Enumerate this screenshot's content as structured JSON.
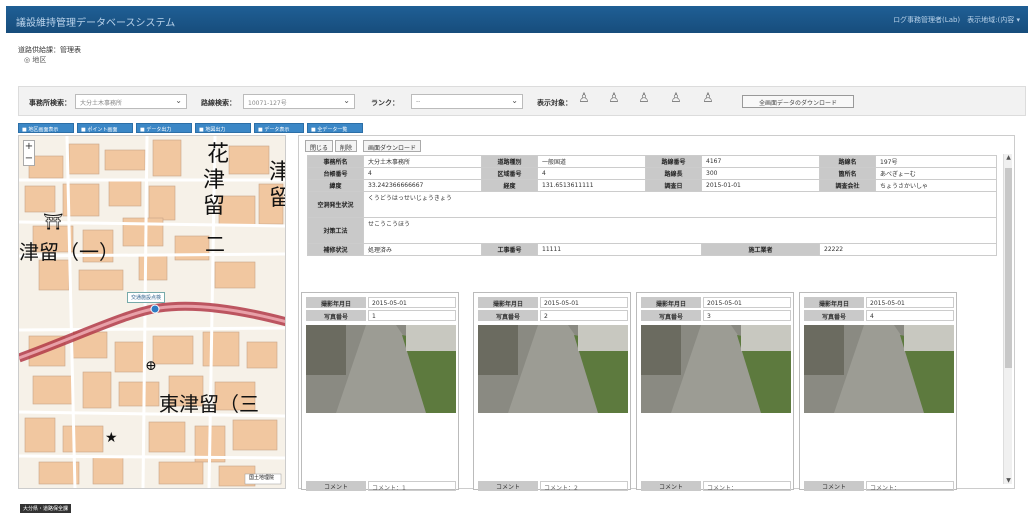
{
  "header": {
    "title": "議設維持管理データベースシステム",
    "user": "ログ事務管理者(Lab)　表示地域:(内容 ▾"
  },
  "breadcrumb": {
    "path": "道路供給課：管理表",
    "sub": "◎ 地区"
  },
  "filters": {
    "office_label": "事務所検索：",
    "office_value": "大分土木事務所",
    "road_label": "路線検索：",
    "road_value": "10071-127号",
    "rank_label": "ランク：",
    "rank_value": "--",
    "display_label": "表示対象：",
    "download_label": "全画面データのダウンロード"
  },
  "map_buttons": [
    "■ 地区画面表示",
    "■ ポイント画面",
    "■ データ出力",
    "■ 地図出力",
    "■ データ表示",
    "■ 全データ一覧"
  ],
  "map": {
    "labels": [
      "花",
      "津",
      "留",
      "津",
      "留",
      "津留（一）",
      "東津留（三",
      "二"
    ],
    "pin_label": "交通施設点検",
    "map_note": "国土地理院"
  },
  "panel": {
    "tabs": [
      "閉じる",
      "削除",
      "画面ダウンロード"
    ],
    "info": {
      "office_k": "事務所名",
      "office_v": "大分土木事務所",
      "road_type_k": "道路種別",
      "road_type_v": "一般国道",
      "road_no_k": "路線番号",
      "road_no_v": "4167",
      "route_k": "路線名",
      "route_v": "197号",
      "admin_k": "台帳番号",
      "admin_v": "4",
      "section_k": "区域番号",
      "section_v": "4",
      "ward_k": "路線長",
      "ward_v": "300",
      "place_k": "箇所名",
      "place_v": "あべぎょーむ",
      "lat_k": "緯度",
      "lat_v": "33.242366666667",
      "lng_k": "経度",
      "lng_v": "131.6513611111",
      "date_k": "調査日",
      "date_v": "2015-01-01",
      "company_k": "調査会社",
      "company_v": "ちょうさかいしゃ",
      "status_k": "空洞発生状況",
      "status_v": "くうどうはっせいじょうきょう",
      "method_k": "対策工法",
      "method_v": "せこうこうほう",
      "repair_k": "補修状況",
      "repair_v": "処理済み",
      "work_no_k": "工事番号",
      "work_no_v": "11111",
      "contractor_k": "施工業者",
      "contractor_v": "22222"
    },
    "photos": [
      {
        "date_k": "撮影年月日",
        "date_v": "2015-05-01",
        "no_k": "写真番号",
        "no_v": "1",
        "comment_k": "コメント",
        "comment_v": "コメント：1"
      },
      {
        "date_k": "撮影年月日",
        "date_v": "2015-05-01",
        "no_k": "写真番号",
        "no_v": "2",
        "comment_k": "コメント",
        "comment_v": "コメント：2"
      },
      {
        "date_k": "撮影年月日",
        "date_v": "2015-05-01",
        "no_k": "写真番号",
        "no_v": "3",
        "comment_k": "コメント",
        "comment_v": "コメント："
      },
      {
        "date_k": "撮影年月日",
        "date_v": "2015-05-01",
        "no_k": "写真番号",
        "no_v": "4",
        "comment_k": "コメント",
        "comment_v": "コメント："
      }
    ]
  },
  "footer": "大分県・道路保全課",
  "colors": {
    "header": "#1f5f95",
    "button": "#3b87c6",
    "label_bg": "#c9c9c9",
    "road": "#b23a48"
  }
}
